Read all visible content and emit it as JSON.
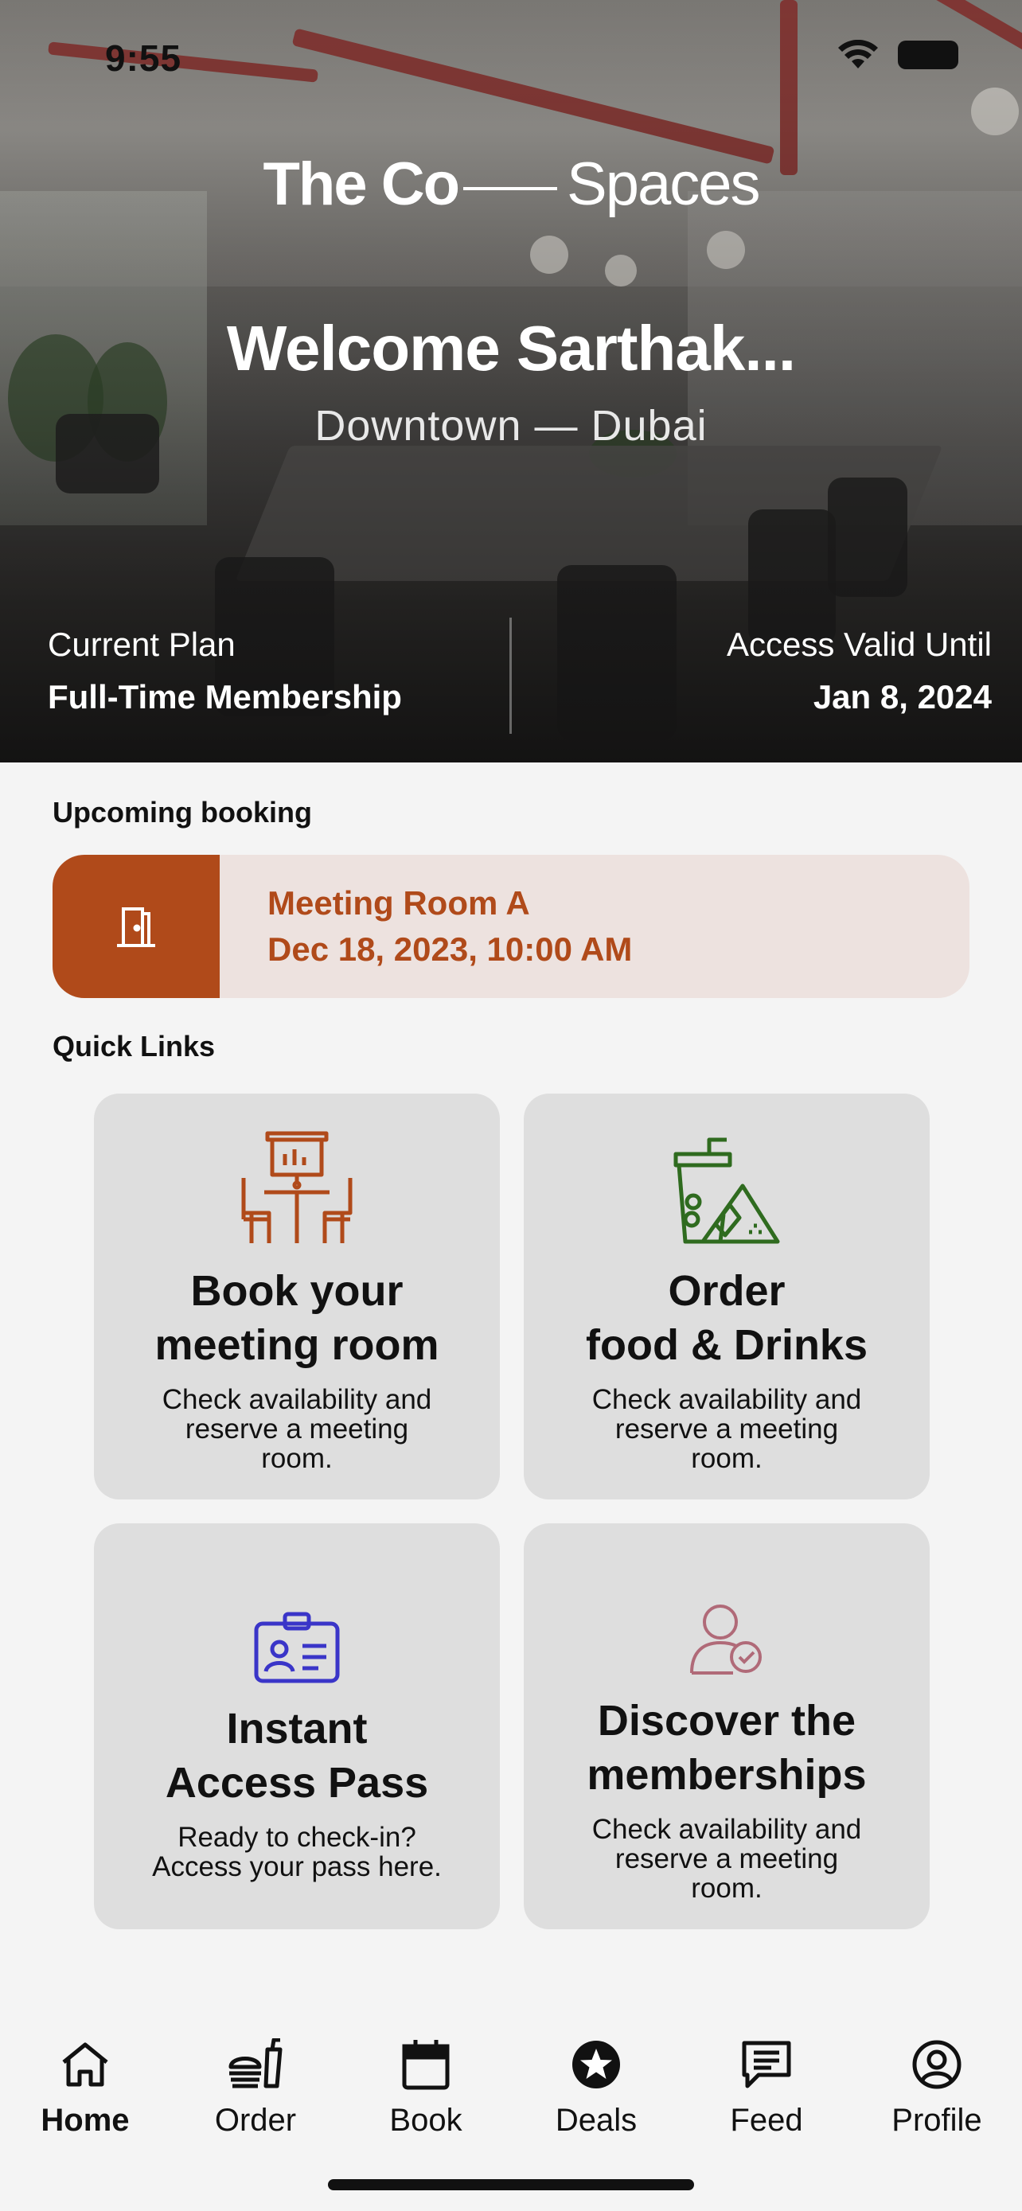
{
  "status_bar": {
    "time": "9:55"
  },
  "hero": {
    "brand_bold": "The Co",
    "brand_light": "Spaces",
    "welcome": "Welcome Sarthak...",
    "location": "Downtown — Dubai",
    "plan_label": "Current Plan",
    "plan_value": "Full-Time Membership",
    "access_label": "Access Valid Until",
    "access_value": "Jan 8, 2024"
  },
  "upcoming": {
    "section_title": "Upcoming booking",
    "room": "Meeting Room A",
    "datetime": "Dec 18, 2023, 10:00 AM"
  },
  "quick_links": {
    "section_title": "Quick Links",
    "cards": [
      {
        "title_line1": "Book your",
        "title_line2": "meeting room",
        "desc_line1": "Check availability and",
        "desc_line2": "reserve a meeting",
        "desc_line3": "room.",
        "icon": "meeting-room-icon"
      },
      {
        "title_line1": "Order",
        "title_line2": "food & Drinks",
        "desc_line1": "Check availability and",
        "desc_line2": "reserve a meeting",
        "desc_line3": "room.",
        "icon": "food-drink-icon"
      },
      {
        "title_line1": "Instant",
        "title_line2": "Access Pass",
        "desc_line1": "Ready to check-in?",
        "desc_line2": "Access your pass here.",
        "desc_line3": "",
        "icon": "id-card-icon"
      },
      {
        "title_line1": "Discover the",
        "title_line2": "memberships",
        "desc_line1": "Check availability and",
        "desc_line2": "reserve a meeting",
        "desc_line3": "room.",
        "icon": "member-check-icon"
      }
    ]
  },
  "nav": {
    "items": [
      {
        "label": "Home",
        "icon": "home-icon"
      },
      {
        "label": "Order",
        "icon": "order-icon"
      },
      {
        "label": "Book",
        "icon": "calendar-icon"
      },
      {
        "label": "Deals",
        "icon": "star-icon"
      },
      {
        "label": "Feed",
        "icon": "chat-icon"
      },
      {
        "label": "Profile",
        "icon": "profile-icon"
      }
    ]
  },
  "colors": {
    "accent": "#b04a1a",
    "booking_bg": "#ede2df",
    "card_bg": "#dedede",
    "food_icon": "#2f6b1f",
    "pass_icon": "#3a35c8",
    "member_icon": "#b06a78"
  }
}
